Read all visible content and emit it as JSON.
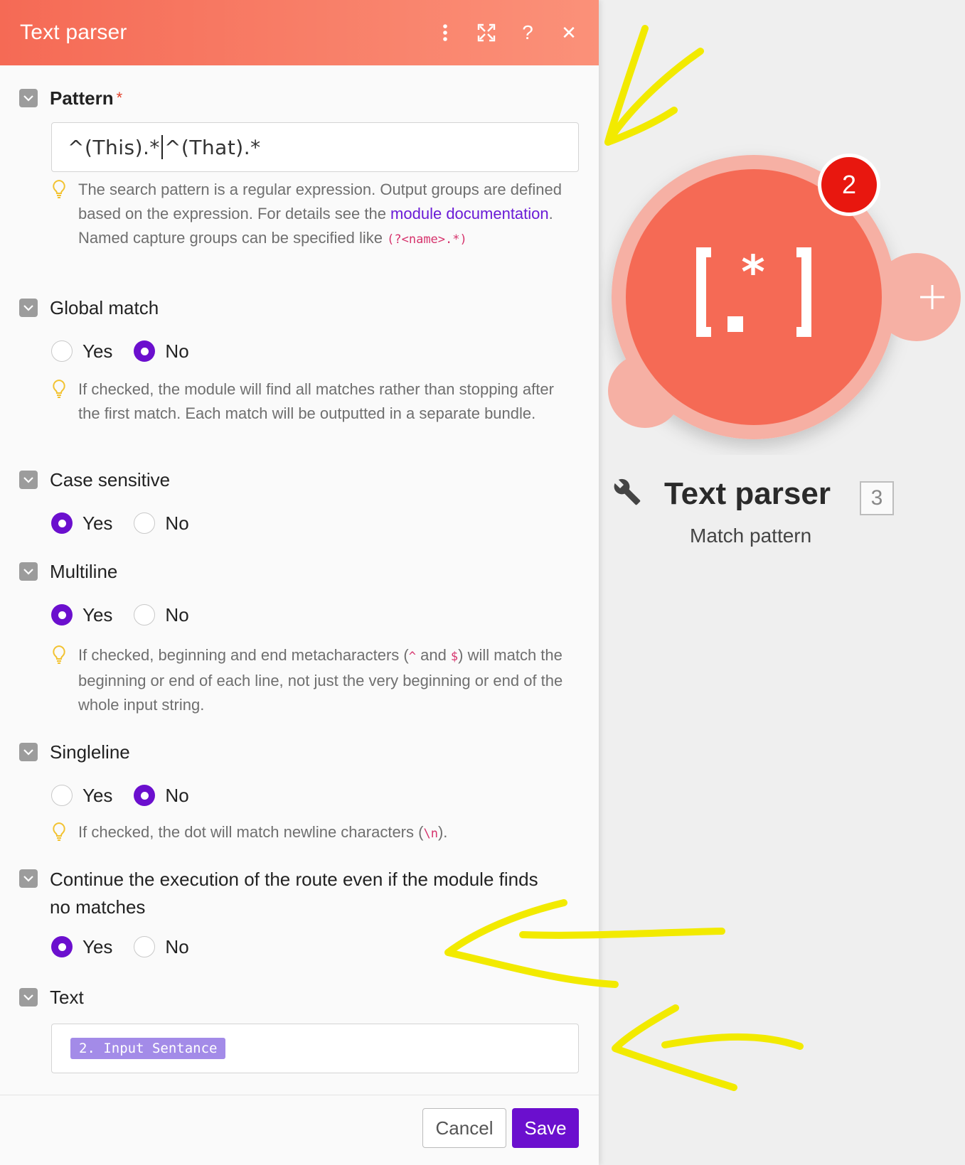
{
  "header": {
    "title": "Text parser",
    "menu_icon": "kebab-menu-icon",
    "expand_icon": "expand-icon",
    "help_label": "?",
    "close_label": "✕"
  },
  "pattern": {
    "label": "Pattern",
    "required_mark": "*",
    "value_before_caret": "^(This).*",
    "value_after_caret": "^(That).*",
    "hint_part1": "The search pattern is a regular expression. Output groups are defined based on the expression. For details see the ",
    "hint_link": "module documentation",
    "hint_part2": ".",
    "hint_line2": "Named capture groups can be specified like ",
    "hint_code": "(?<name>.*)"
  },
  "global_match": {
    "label": "Global match",
    "yes": "Yes",
    "no": "No",
    "selected": "No",
    "hint": "If checked, the module will find all matches rather than stopping after the first match. Each match will be outputted in a separate bundle."
  },
  "case_sensitive": {
    "label": "Case sensitive",
    "yes": "Yes",
    "no": "No",
    "selected": "Yes"
  },
  "multiline": {
    "label": "Multiline",
    "yes": "Yes",
    "no": "No",
    "selected": "Yes",
    "hint_part1": "If checked, beginning and end metacharacters (",
    "hint_code1": "^",
    "hint_part2": " and ",
    "hint_code2": "$",
    "hint_part3": ") will match the beginning or end of each line, not just the very beginning or end of the whole input string."
  },
  "singleline": {
    "label": "Singleline",
    "yes": "Yes",
    "no": "No",
    "selected": "No",
    "hint_part1": "If checked, the dot will match newline characters (",
    "hint_code": "\\n",
    "hint_part2": ")."
  },
  "continue_execution": {
    "label": "Continue the execution of the route even if the module finds no matches",
    "yes": "Yes",
    "no": "No",
    "selected": "Yes"
  },
  "text": {
    "label": "Text",
    "pill": "2. Input Sentance"
  },
  "footer": {
    "cancel": "Cancel",
    "save": "Save"
  },
  "module": {
    "name": "Text parser",
    "id": "3",
    "subtitle": "Match pattern",
    "badge": "2",
    "icon": "regex-icon",
    "add_icon": "plus-icon"
  },
  "colors": {
    "header_start": "#f56a55",
    "header_end": "#fb9179",
    "accent": "#6b0fce",
    "module": "#f56a55",
    "badge": "#e8170f",
    "annotation": "#f2ea00"
  }
}
